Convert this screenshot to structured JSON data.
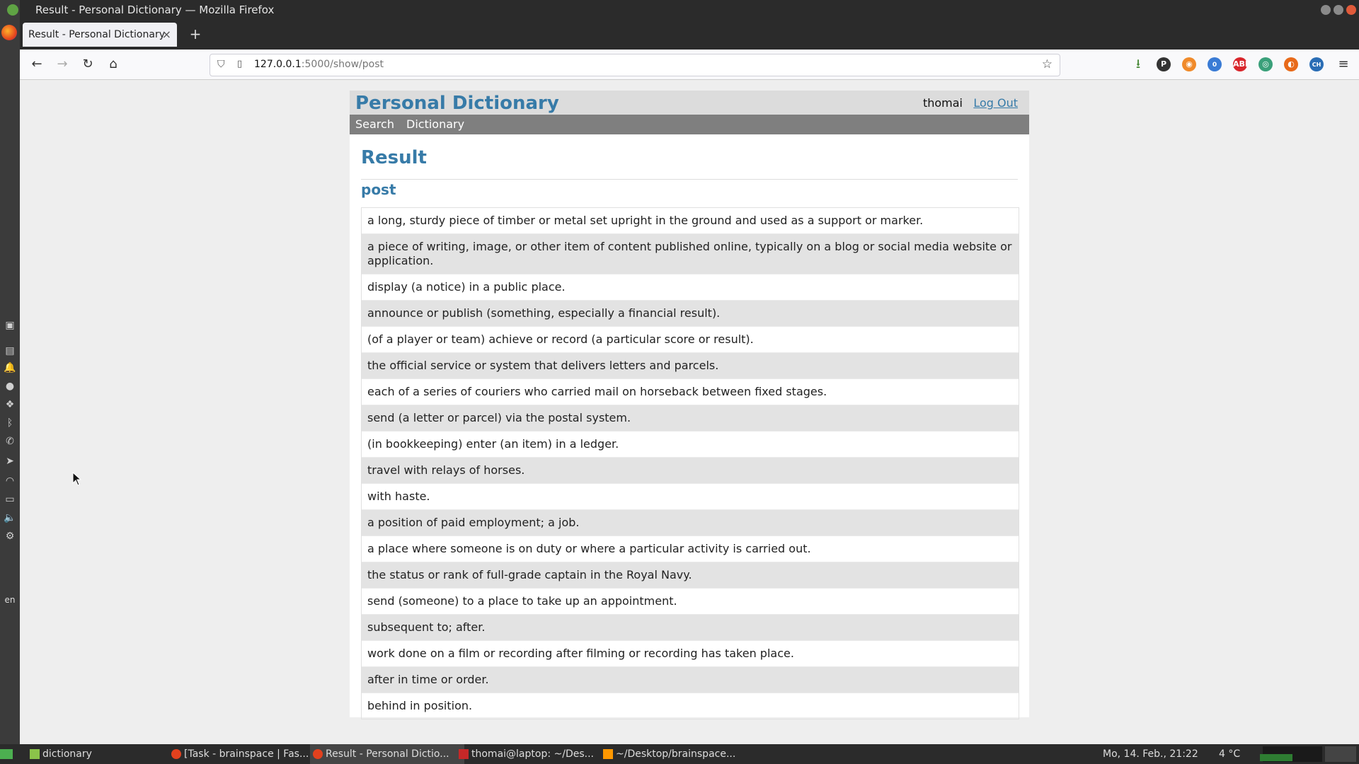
{
  "window": {
    "title": "Result - Personal Dictionary — Mozilla Firefox"
  },
  "browser": {
    "tab_label": "Result - Personal Dictionary",
    "url_host": "127.0.0.1",
    "url_path": ":5000/show/post",
    "extension_badge": "0",
    "extension_ch": "CH"
  },
  "site": {
    "title": "Personal Dictionary",
    "username": "thomai",
    "logout_label": "Log Out",
    "nav": [
      "Search",
      "Dictionary"
    ]
  },
  "main": {
    "heading": "Result",
    "word": "post",
    "definitions": [
      "a long, sturdy piece of timber or metal set upright in the ground and used as a support or marker.",
      "a piece of writing, image, or other item of content published online, typically on a blog or social media website or application.",
      "display (a notice) in a public place.",
      "announce or publish (something, especially a financial result).",
      "(of a player or team) achieve or record (a particular score or result).",
      "the official service or system that delivers letters and parcels.",
      "each of a series of couriers who carried mail on horseback between fixed stages.",
      "send (a letter or parcel) via the postal system.",
      "(in bookkeeping) enter (an item) in a ledger.",
      "travel with relays of horses.",
      "with haste.",
      "a position of paid employment; a job.",
      "a place where someone is on duty or where a particular activity is carried out.",
      "the status or rank of full-grade captain in the Royal Navy.",
      "send (someone) to a place to take up an appointment.",
      "subsequent to; after.",
      "work done on a film or recording after filming or recording has taken place.",
      "after in time or order.",
      "behind in position."
    ]
  },
  "dock": {
    "lang": "en"
  },
  "taskbar": {
    "apps": [
      "dictionary",
      "[Task - brainspace | Fas...",
      "Result - Personal Dictio...",
      "thomai@laptop: ~/Des...",
      "~/Desktop/brainspace..."
    ],
    "clock": "Mo, 14. Feb., 21:22",
    "weather": "4 °C"
  },
  "colors": {
    "accent": "#377ba8",
    "header_bg": "#dcdcdc",
    "nav_bg": "#7f7f7f",
    "row_alt": "#e3e3e3"
  }
}
